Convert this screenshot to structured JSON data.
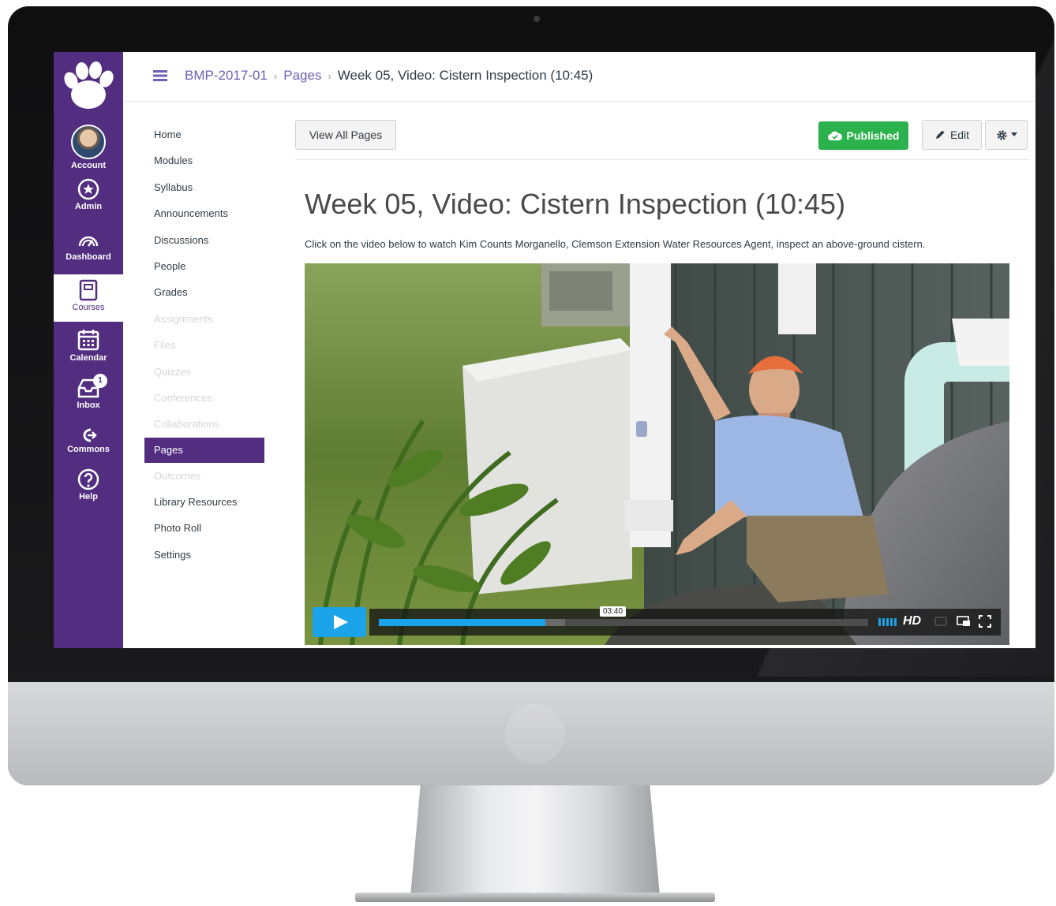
{
  "breadcrumb": {
    "course": "BMP-2017-01",
    "section": "Pages",
    "current": "Week 05, Video: Cistern Inspection (10:45)"
  },
  "global_nav": [
    {
      "label": "Account",
      "icon": "avatar"
    },
    {
      "label": "Admin",
      "icon": "shield-icon"
    },
    {
      "label": "Dashboard",
      "icon": "speedometer-icon"
    },
    {
      "label": "Courses",
      "icon": "book-icon",
      "active": true
    },
    {
      "label": "Calendar",
      "icon": "calendar-icon"
    },
    {
      "label": "Inbox",
      "icon": "inbox-icon",
      "badge": "1"
    },
    {
      "label": "Commons",
      "icon": "commons-icon"
    },
    {
      "label": "Help",
      "icon": "help-icon"
    }
  ],
  "course_nav": [
    {
      "label": "Home"
    },
    {
      "label": "Modules"
    },
    {
      "label": "Syllabus"
    },
    {
      "label": "Announcements"
    },
    {
      "label": "Discussions"
    },
    {
      "label": "People"
    },
    {
      "label": "Grades"
    },
    {
      "label": "Assignments",
      "disabled": true
    },
    {
      "label": "Files",
      "disabled": true
    },
    {
      "label": "Quizzes",
      "disabled": true
    },
    {
      "label": "Conferences",
      "disabled": true
    },
    {
      "label": "Collaborations",
      "disabled": true
    },
    {
      "label": "Pages",
      "active": true
    },
    {
      "label": "Outcomes",
      "disabled": true
    },
    {
      "label": "Library Resources"
    },
    {
      "label": "Photo Roll"
    },
    {
      "label": "Settings"
    }
  ],
  "toolbar": {
    "view_all": "View All Pages",
    "published": "Published",
    "edit": "Edit"
  },
  "page": {
    "title": "Week 05, Video: Cistern Inspection (10:45)",
    "description": "Click on the video below to watch Kim Counts Morganello, Clemson Extension Water Resources Agent, inspect an above-ground cistern."
  },
  "video": {
    "timecode": "03:40",
    "progress": 0.34,
    "loaded": 0.38,
    "quality": "HD"
  },
  "colors": {
    "brand": "#522d80",
    "published": "#2bb24c",
    "player_accent": "#1aa3e8",
    "link": "#6f5fb3"
  }
}
